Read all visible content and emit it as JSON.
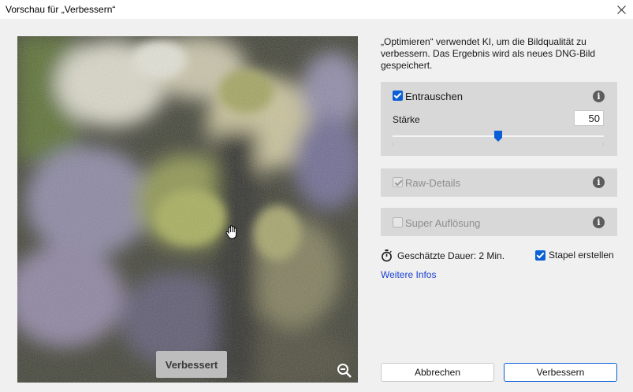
{
  "window": {
    "title": "Vorschau für „Verbessern“",
    "close_icon": "close-icon"
  },
  "preview": {
    "badge": "Verbessert",
    "zoom_icon": "zoom-out-icon",
    "cursor_icon": "hand-icon"
  },
  "description": "„Optimieren“ verwendet KI, um die Bildqualität zu verbessern. Das Ergebnis wird als neues DNG-Bild gespeichert.",
  "denoise": {
    "label": "Entrauschen",
    "checked": true,
    "strength_label": "Stärke",
    "value": "50",
    "slider_fraction": 0.5
  },
  "raw_details": {
    "label": "Raw-Details",
    "checked": true,
    "enabled": false
  },
  "super_resolution": {
    "label": "Super Auflösung",
    "checked": false,
    "enabled": false
  },
  "footer": {
    "duration": "Geschätzte Dauer: 2 Min.",
    "stack_label": "Stapel erstellen",
    "stack_checked": true,
    "more_info": "Weitere Infos"
  },
  "buttons": {
    "cancel": "Abbrechen",
    "apply": "Verbessern"
  },
  "colors": {
    "accent": "#0a5fd6",
    "link": "#1a3fd0",
    "panel": "#d8d8d8"
  }
}
